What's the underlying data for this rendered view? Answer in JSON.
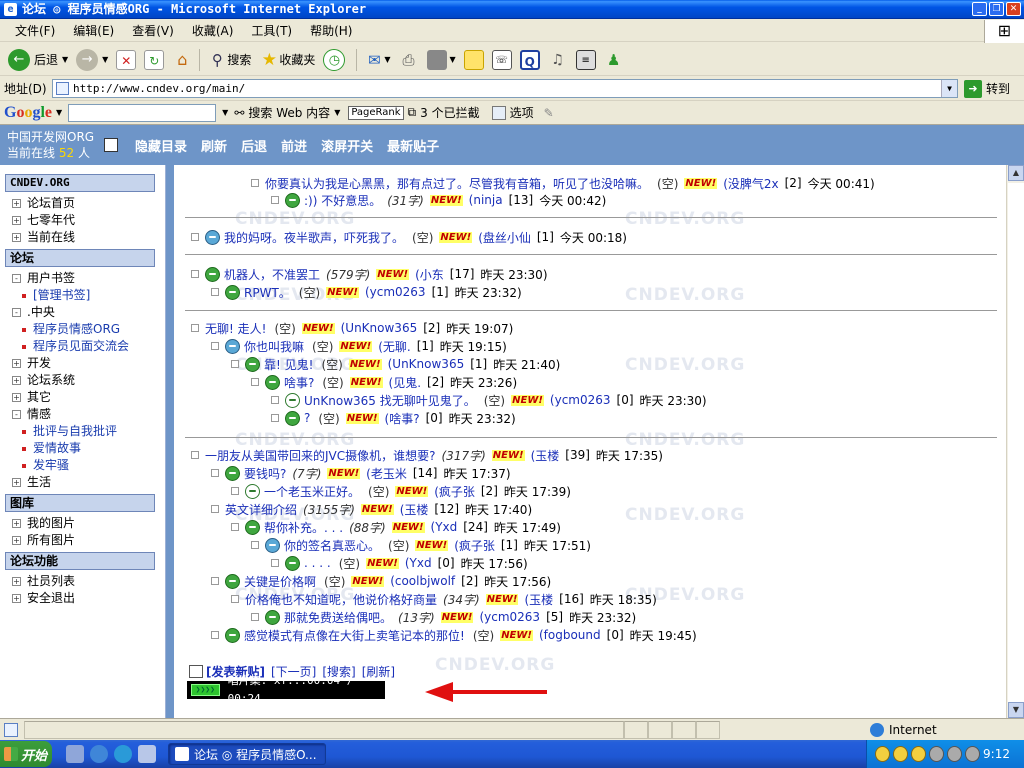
{
  "window": {
    "title": "论坛 ◎ 程序员情感ORG - Microsoft Internet Explorer"
  },
  "menu": [
    "文件(F)",
    "编辑(E)",
    "查看(V)",
    "收藏(A)",
    "工具(T)",
    "帮助(H)"
  ],
  "toolbar": {
    "back": "后退",
    "search": "搜索",
    "favorites": "收藏夹"
  },
  "address": {
    "label": "地址(D)",
    "url": "http://www.cndev.org/main/",
    "go": "转到"
  },
  "google": {
    "logo": [
      "G",
      "o",
      "o",
      "g",
      "l",
      "e"
    ],
    "search_web": "搜索 Web 内容",
    "pagerank": "PageRank",
    "blocked": "3 个已拦截",
    "options": "选项"
  },
  "forum": {
    "brand": "中国开发网ORG",
    "online_label": "当前在线",
    "online_count": "52",
    "online_unit": "人",
    "nav": [
      "隐藏目录",
      "刷新",
      "后退",
      "前进",
      "滚屏开关",
      "最新贴子"
    ]
  },
  "sidebar": [
    {
      "type": "head",
      "label": "CNDEV.ORG"
    },
    {
      "type": "item",
      "label": "论坛首页",
      "box": "+"
    },
    {
      "type": "item",
      "label": "七零年代",
      "box": "+"
    },
    {
      "type": "item",
      "label": "当前在线",
      "box": "+"
    },
    {
      "type": "head",
      "label": "论坛"
    },
    {
      "type": "item",
      "label": "用户书签",
      "box": "-"
    },
    {
      "type": "sub",
      "label": "[管理书签]"
    },
    {
      "type": "item",
      "label": ".中央",
      "box": "-"
    },
    {
      "type": "sub",
      "label": "程序员情感ORG"
    },
    {
      "type": "sub",
      "label": "程序员见面交流会"
    },
    {
      "type": "item",
      "label": "开发",
      "box": "+"
    },
    {
      "type": "item",
      "label": "论坛系统",
      "box": "+"
    },
    {
      "type": "item",
      "label": "其它",
      "box": "+"
    },
    {
      "type": "item",
      "label": "情感",
      "box": "-"
    },
    {
      "type": "sub",
      "label": "批评与自我批评"
    },
    {
      "type": "sub",
      "label": "爱情故事"
    },
    {
      "type": "sub",
      "label": "发牢骚"
    },
    {
      "type": "item",
      "label": "生活",
      "box": "+"
    },
    {
      "type": "head",
      "label": "图库"
    },
    {
      "type": "item",
      "label": "我的图片",
      "box": "+"
    },
    {
      "type": "item",
      "label": "所有图片",
      "box": "+"
    },
    {
      "type": "head",
      "label": "论坛功能"
    },
    {
      "type": "item",
      "label": "社员列表",
      "box": "+"
    },
    {
      "type": "item",
      "label": "安全退出",
      "box": "+"
    }
  ],
  "new_badge": "NEW!",
  "watermark": "CNDEV.ORG",
  "posts": [
    {
      "indent": 3,
      "face": "",
      "title": "你要真认为我是心黑黑，那有点过了。尽管我有音箱，听见了也没哈嘛。",
      "size": "",
      "kong": "(空)",
      "author": "(没脾气2x",
      "replies": "[2]",
      "time": "今天 00:41)"
    },
    {
      "indent": 4,
      "face": "green",
      "title": ":)) 不好意思。",
      "size": "(31字)",
      "kong": "",
      "author": "(ninja",
      "replies": "[13]",
      "time": "今天 00:42)"
    },
    {
      "indent": 0,
      "face": "blue",
      "title": "我的妈呀。夜半歌声，吓死我了。",
      "size": "",
      "kong": "(空)",
      "author": "(盘丝小仙",
      "replies": "[1]",
      "time": "今天 00:18)"
    },
    {
      "indent": 0,
      "face": "green",
      "title": "机器人，不准罢工",
      "size": "(579字)",
      "kong": "",
      "author": "(小东",
      "replies": "[17]",
      "time": "昨天 23:30)"
    },
    {
      "indent": 1,
      "face": "green",
      "title": "RPWT。",
      "size": "",
      "kong": "(空)",
      "author": "(ycm0263",
      "replies": "[1]",
      "time": "昨天 23:32)"
    },
    {
      "indent": 0,
      "face": "",
      "title": "无聊! 走人!",
      "size": "",
      "kong": "(空)",
      "author": "(UnKnow365",
      "replies": "[2]",
      "time": "昨天 19:07)"
    },
    {
      "indent": 1,
      "face": "blue",
      "title": "你也叫我嘛",
      "size": "",
      "kong": "(空)",
      "author": "(无聊.",
      "replies": "[1]",
      "time": "昨天 19:15)"
    },
    {
      "indent": 2,
      "face": "green",
      "title": "靠! 见鬼!",
      "size": "",
      "kong": "(空)",
      "author": "(UnKnow365",
      "replies": "[1]",
      "time": "昨天 21:40)"
    },
    {
      "indent": 3,
      "face": "green",
      "title": "啥事?",
      "size": "",
      "kong": "(空)",
      "author": "(见鬼.",
      "replies": "[2]",
      "time": "昨天 23:26)"
    },
    {
      "indent": 4,
      "face": "white",
      "title": "UnKnow365 找无聊叶见鬼了。",
      "size": "",
      "kong": "(空)",
      "author": "(ycm0263",
      "replies": "[0]",
      "time": "昨天 23:30)"
    },
    {
      "indent": 4,
      "face": "green",
      "title": "?",
      "size": "",
      "kong": "(空)",
      "author": "(啥事?",
      "replies": "[0]",
      "time": "昨天 23:32)"
    },
    {
      "indent": 0,
      "face": "",
      "title": "一朋友从美国带回来的JVC摄像机，谁想要?",
      "size": "(317字)",
      "kong": "",
      "author": "(玉楼",
      "replies": "[39]",
      "time": "昨天 17:35)"
    },
    {
      "indent": 1,
      "face": "green",
      "title": "要钱吗?",
      "size": "(7字)",
      "kong": "",
      "author": "(老玉米",
      "replies": "[14]",
      "time": "昨天 17:37)"
    },
    {
      "indent": 2,
      "face": "white",
      "title": "一个老玉米正好。",
      "size": "",
      "kong": "(空)",
      "author": "(疯子张",
      "replies": "[2]",
      "time": "昨天 17:39)"
    },
    {
      "indent": 1,
      "face": "",
      "title": "英文详细介绍",
      "size": "(3155字)",
      "kong": "",
      "author": "(玉楼",
      "replies": "[12]",
      "time": "昨天 17:40)"
    },
    {
      "indent": 2,
      "face": "green",
      "title": "帮你补充。. . .",
      "size": "(88字)",
      "kong": "",
      "author": "(Yxd",
      "replies": "[24]",
      "time": "昨天 17:49)"
    },
    {
      "indent": 3,
      "face": "blue",
      "title": "你的签名真恶心。",
      "size": "",
      "kong": "(空)",
      "author": "(疯子张",
      "replies": "[1]",
      "time": "昨天 17:51)"
    },
    {
      "indent": 4,
      "face": "green",
      "title": ". . . .",
      "size": "",
      "kong": "(空)",
      "author": "(Yxd",
      "replies": "[0]",
      "time": "昨天 17:56)"
    },
    {
      "indent": 1,
      "face": "green",
      "title": "关键是价格啊",
      "size": "",
      "kong": "(空)",
      "author": "(coolbjwolf",
      "replies": "[2]",
      "time": "昨天 17:56)"
    },
    {
      "indent": 2,
      "face": "",
      "title": "价格俺也不知道呢，他说价格好商量",
      "size": "(34字)",
      "kong": "",
      "author": "(玉楼",
      "replies": "[16]",
      "time": "昨天 18:35)"
    },
    {
      "indent": 3,
      "face": "green",
      "title": "那就免费送给偶吧。",
      "size": "(13字)",
      "kong": "",
      "author": "(ycm0263",
      "replies": "[5]",
      "time": "昨天 23:32)"
    },
    {
      "indent": 1,
      "face": "green",
      "title": "感觉模式有点像在大街上卖笔记本的那位!",
      "size": "",
      "kong": "(空)",
      "author": "(fogbound",
      "replies": "[0]",
      "time": "昨天 19:45)"
    }
  ],
  "bottom_links": [
    "[发表新贴]",
    "[下一页]",
    "[搜索]",
    "[刷新]"
  ],
  "player": {
    "text": "唱片集: xf...00:04 / 00:24"
  },
  "status": {
    "zone": "Internet"
  },
  "taskbar": {
    "start": "开始",
    "task": "论坛 ◎ 程序员情感O...",
    "clock": "9:12"
  }
}
